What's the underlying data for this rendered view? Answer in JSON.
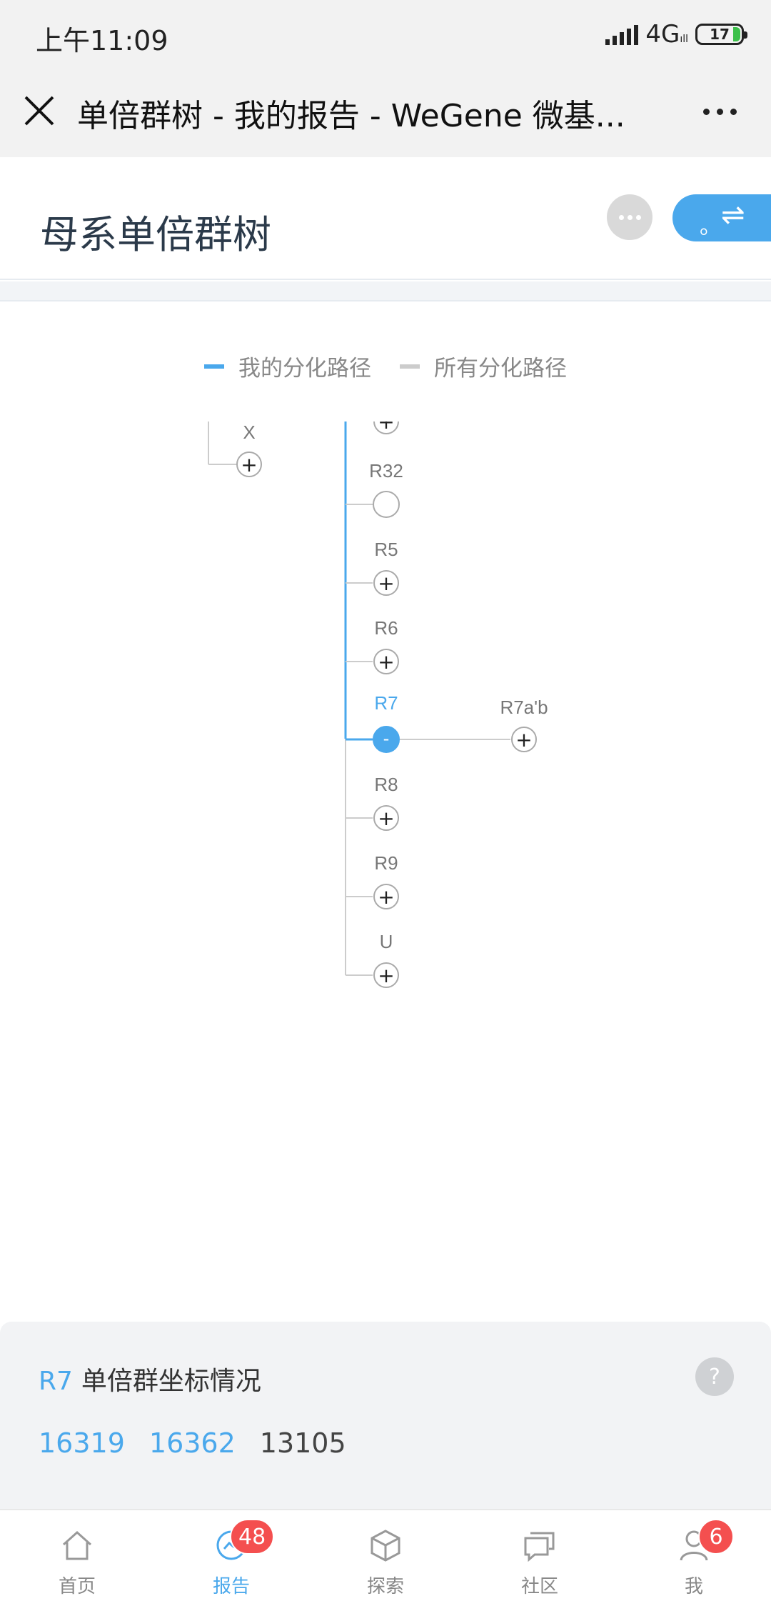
{
  "status_bar": {
    "time": "上午11:09",
    "network": "4G",
    "network_sub": "ıll",
    "battery": "17"
  },
  "nav": {
    "title": "单倍群树 - 我的报告 - WeGene 微基..."
  },
  "header": {
    "title": "母系单倍群树",
    "switch_dot": "。",
    "switch_arrows": "⇌"
  },
  "legend": [
    {
      "label": "我的分化路径",
      "color": "#4aa8ec"
    },
    {
      "label": "所有分化路径",
      "color": "#cccccc"
    }
  ],
  "tree": {
    "nodes": [
      {
        "label": "X",
        "expand": "+"
      },
      {
        "label": "",
        "expand": "+"
      },
      {
        "label": "R32",
        "expand": ""
      },
      {
        "label": "R5",
        "expand": "+"
      },
      {
        "label": "R6",
        "expand": "+"
      },
      {
        "label": "R7",
        "expand": "-"
      },
      {
        "label": "R7a'b",
        "expand": "+"
      },
      {
        "label": "R8",
        "expand": "+"
      },
      {
        "label": "R9",
        "expand": "+"
      },
      {
        "label": "U",
        "expand": "+"
      }
    ]
  },
  "info": {
    "haplogroup": "R7",
    "title": "单倍群坐标情况",
    "help": "?",
    "coords": [
      {
        "value": "16319",
        "highlight": true
      },
      {
        "value": "16362",
        "highlight": true
      },
      {
        "value": "13105",
        "highlight": false
      }
    ]
  },
  "tabs": [
    {
      "label": "首页",
      "icon": "home-icon",
      "badge": ""
    },
    {
      "label": "报告",
      "icon": "report-icon",
      "badge": "48",
      "active": true
    },
    {
      "label": "探索",
      "icon": "cube-icon",
      "badge": ""
    },
    {
      "label": "社区",
      "icon": "chat-icon",
      "badge": ""
    },
    {
      "label": "我",
      "icon": "user-icon",
      "badge": "6"
    }
  ],
  "colors": {
    "accent": "#4aa8ec",
    "badge": "#f44f4f",
    "line": "#cccccc"
  }
}
